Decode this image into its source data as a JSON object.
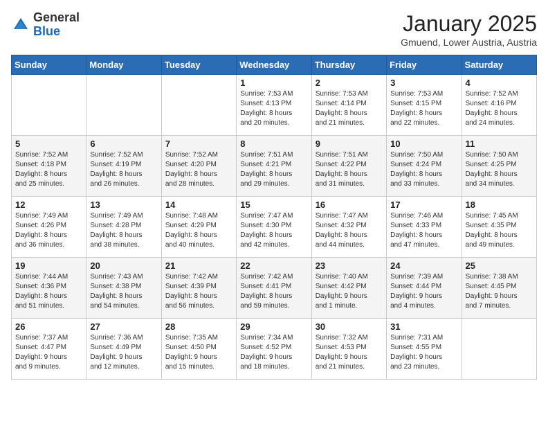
{
  "header": {
    "logo_general": "General",
    "logo_blue": "Blue",
    "month_title": "January 2025",
    "subtitle": "Gmuend, Lower Austria, Austria"
  },
  "days_of_week": [
    "Sunday",
    "Monday",
    "Tuesday",
    "Wednesday",
    "Thursday",
    "Friday",
    "Saturday"
  ],
  "weeks": [
    [
      {
        "day": "",
        "info": ""
      },
      {
        "day": "",
        "info": ""
      },
      {
        "day": "",
        "info": ""
      },
      {
        "day": "1",
        "info": "Sunrise: 7:53 AM\nSunset: 4:13 PM\nDaylight: 8 hours\nand 20 minutes."
      },
      {
        "day": "2",
        "info": "Sunrise: 7:53 AM\nSunset: 4:14 PM\nDaylight: 8 hours\nand 21 minutes."
      },
      {
        "day": "3",
        "info": "Sunrise: 7:53 AM\nSunset: 4:15 PM\nDaylight: 8 hours\nand 22 minutes."
      },
      {
        "day": "4",
        "info": "Sunrise: 7:52 AM\nSunset: 4:16 PM\nDaylight: 8 hours\nand 24 minutes."
      }
    ],
    [
      {
        "day": "5",
        "info": "Sunrise: 7:52 AM\nSunset: 4:18 PM\nDaylight: 8 hours\nand 25 minutes."
      },
      {
        "day": "6",
        "info": "Sunrise: 7:52 AM\nSunset: 4:19 PM\nDaylight: 8 hours\nand 26 minutes."
      },
      {
        "day": "7",
        "info": "Sunrise: 7:52 AM\nSunset: 4:20 PM\nDaylight: 8 hours\nand 28 minutes."
      },
      {
        "day": "8",
        "info": "Sunrise: 7:51 AM\nSunset: 4:21 PM\nDaylight: 8 hours\nand 29 minutes."
      },
      {
        "day": "9",
        "info": "Sunrise: 7:51 AM\nSunset: 4:22 PM\nDaylight: 8 hours\nand 31 minutes."
      },
      {
        "day": "10",
        "info": "Sunrise: 7:50 AM\nSunset: 4:24 PM\nDaylight: 8 hours\nand 33 minutes."
      },
      {
        "day": "11",
        "info": "Sunrise: 7:50 AM\nSunset: 4:25 PM\nDaylight: 8 hours\nand 34 minutes."
      }
    ],
    [
      {
        "day": "12",
        "info": "Sunrise: 7:49 AM\nSunset: 4:26 PM\nDaylight: 8 hours\nand 36 minutes."
      },
      {
        "day": "13",
        "info": "Sunrise: 7:49 AM\nSunset: 4:28 PM\nDaylight: 8 hours\nand 38 minutes."
      },
      {
        "day": "14",
        "info": "Sunrise: 7:48 AM\nSunset: 4:29 PM\nDaylight: 8 hours\nand 40 minutes."
      },
      {
        "day": "15",
        "info": "Sunrise: 7:47 AM\nSunset: 4:30 PM\nDaylight: 8 hours\nand 42 minutes."
      },
      {
        "day": "16",
        "info": "Sunrise: 7:47 AM\nSunset: 4:32 PM\nDaylight: 8 hours\nand 44 minutes."
      },
      {
        "day": "17",
        "info": "Sunrise: 7:46 AM\nSunset: 4:33 PM\nDaylight: 8 hours\nand 47 minutes."
      },
      {
        "day": "18",
        "info": "Sunrise: 7:45 AM\nSunset: 4:35 PM\nDaylight: 8 hours\nand 49 minutes."
      }
    ],
    [
      {
        "day": "19",
        "info": "Sunrise: 7:44 AM\nSunset: 4:36 PM\nDaylight: 8 hours\nand 51 minutes."
      },
      {
        "day": "20",
        "info": "Sunrise: 7:43 AM\nSunset: 4:38 PM\nDaylight: 8 hours\nand 54 minutes."
      },
      {
        "day": "21",
        "info": "Sunrise: 7:42 AM\nSunset: 4:39 PM\nDaylight: 8 hours\nand 56 minutes."
      },
      {
        "day": "22",
        "info": "Sunrise: 7:42 AM\nSunset: 4:41 PM\nDaylight: 8 hours\nand 59 minutes."
      },
      {
        "day": "23",
        "info": "Sunrise: 7:40 AM\nSunset: 4:42 PM\nDaylight: 9 hours\nand 1 minute."
      },
      {
        "day": "24",
        "info": "Sunrise: 7:39 AM\nSunset: 4:44 PM\nDaylight: 9 hours\nand 4 minutes."
      },
      {
        "day": "25",
        "info": "Sunrise: 7:38 AM\nSunset: 4:45 PM\nDaylight: 9 hours\nand 7 minutes."
      }
    ],
    [
      {
        "day": "26",
        "info": "Sunrise: 7:37 AM\nSunset: 4:47 PM\nDaylight: 9 hours\nand 9 minutes."
      },
      {
        "day": "27",
        "info": "Sunrise: 7:36 AM\nSunset: 4:49 PM\nDaylight: 9 hours\nand 12 minutes."
      },
      {
        "day": "28",
        "info": "Sunrise: 7:35 AM\nSunset: 4:50 PM\nDaylight: 9 hours\nand 15 minutes."
      },
      {
        "day": "29",
        "info": "Sunrise: 7:34 AM\nSunset: 4:52 PM\nDaylight: 9 hours\nand 18 minutes."
      },
      {
        "day": "30",
        "info": "Sunrise: 7:32 AM\nSunset: 4:53 PM\nDaylight: 9 hours\nand 21 minutes."
      },
      {
        "day": "31",
        "info": "Sunrise: 7:31 AM\nSunset: 4:55 PM\nDaylight: 9 hours\nand 23 minutes."
      },
      {
        "day": "",
        "info": ""
      }
    ]
  ]
}
